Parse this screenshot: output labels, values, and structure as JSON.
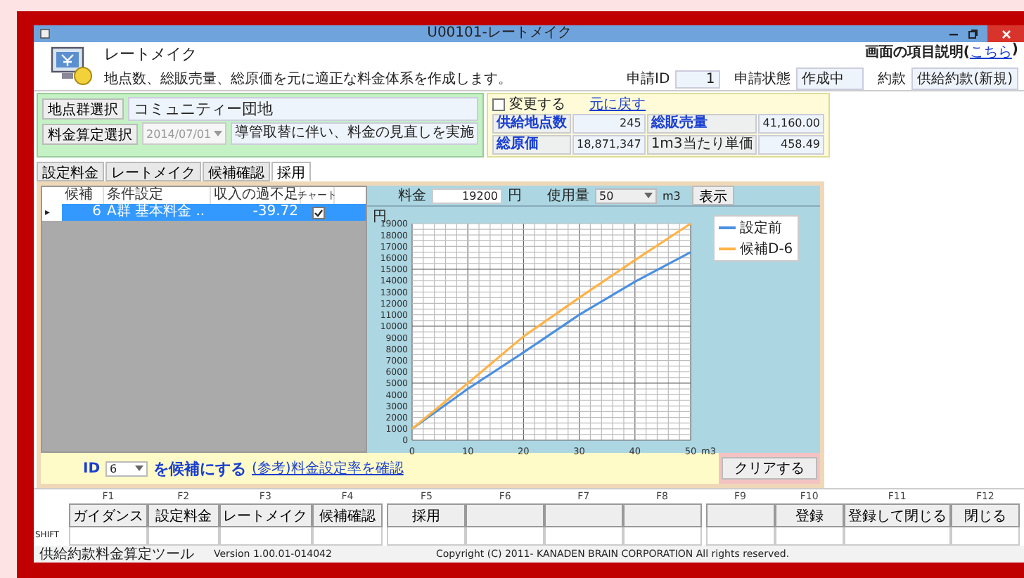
{
  "window": {
    "title": "U00101-レートメイク"
  },
  "header": {
    "title": "レートメイク",
    "description": "地点数、総販売量、総原価を元に適正な料金体系を作成します。",
    "help_label": "画面の項目説明(",
    "help_link": "こちら",
    "help_close": ")"
  },
  "status_fields": [
    {
      "label": "申請ID",
      "value": "1"
    },
    {
      "label": "申請状態",
      "value": "作成中"
    },
    {
      "label": "約款",
      "value": "供給約款(新規)"
    }
  ],
  "selection": {
    "group_button": "地点群選択",
    "group_value": "コミュニティー団地",
    "rate_button": "料金算定選択",
    "date": "2014/07/01",
    "note": "導管取替に伴い、料金の見直しを実施"
  },
  "summary": {
    "change_label": "変更する",
    "change_checked": false,
    "reset_link": "元に戻す",
    "items": [
      {
        "label": "供給地点数",
        "value": "245",
        "emphasis": true
      },
      {
        "label": "総販売量",
        "value": "41,160.00",
        "emphasis": true
      },
      {
        "label": "総原価",
        "value": "18,871,347",
        "emphasis": true
      },
      {
        "label": "1m3当たり単価",
        "value": "458.49",
        "emphasis": false
      }
    ]
  },
  "tabs": [
    {
      "label": "設定料金",
      "selected": false
    },
    {
      "label": "レートメイク",
      "selected": false
    },
    {
      "label": "候補確認",
      "selected": false
    },
    {
      "label": "採用",
      "selected": true
    }
  ],
  "candidates": {
    "columns": [
      "候補",
      "条件設定",
      "収入の過不足",
      "チャート"
    ],
    "rows": [
      {
        "marker": "▸",
        "id": "6",
        "condition": "A群 基本料金 ..",
        "balance": "-39.72",
        "chart": true,
        "selected": true
      }
    ]
  },
  "chart_panel": {
    "fee_label": "料金",
    "fee_value": "19200",
    "fee_unit": "円",
    "usage_label": "使用量",
    "usage_value": "50",
    "usage_unit": "m3",
    "show_button": "表示",
    "chart_data": {
      "type": "line",
      "grid": true,
      "xlabel": "m3",
      "ylabel": "円",
      "x": [
        0,
        10,
        20,
        30,
        40,
        50
      ],
      "xlim": [
        0,
        50
      ],
      "ylim": [
        0,
        19000
      ],
      "xticks": [
        0,
        10,
        20,
        30,
        40,
        50
      ],
      "yticks": [
        0,
        1000,
        2000,
        3000,
        4000,
        5000,
        6000,
        7000,
        8000,
        9000,
        10000,
        11000,
        12000,
        13000,
        14000,
        15000,
        16000,
        17000,
        18000,
        19000
      ],
      "series": [
        {
          "name": "設定前",
          "color": "#4a90e2",
          "values": [
            1000,
            4500,
            7700,
            11000,
            13900,
            16500
          ]
        },
        {
          "name": "候補D-6",
          "color": "#ffb347",
          "values": [
            1000,
            5000,
            9100,
            12500,
            15800,
            19000
          ]
        }
      ]
    }
  },
  "footer": {
    "id_label": "ID",
    "id_value": "6",
    "make_candidate": "を候補にする",
    "ref_link": "(参考)料金設定率を確認",
    "clear_button": "クリアする"
  },
  "function_keys": [
    {
      "key": "F1",
      "label": "ガイダンス"
    },
    {
      "key": "F2",
      "label": "設定料金"
    },
    {
      "key": "F3",
      "label": "レートメイク"
    },
    {
      "key": "F4",
      "label": "候補確認"
    },
    {
      "key": "F5",
      "label": "採用"
    },
    {
      "key": "F6"
    },
    {
      "key": "F7"
    },
    {
      "key": "F8"
    },
    {
      "key": "F9"
    },
    {
      "key": "F10",
      "label": "登録"
    },
    {
      "key": "F11",
      "label": "登録して閉じる"
    },
    {
      "key": "F12",
      "label": "閉じる"
    }
  ],
  "shift_label": "SHIFT",
  "status_bar": [
    "供給約款料金算定ツール",
    "Version 1.00.01-014042",
    "Copyright (C) 2011- KANADEN BRAIN CORPORATION All rights reserved."
  ]
}
